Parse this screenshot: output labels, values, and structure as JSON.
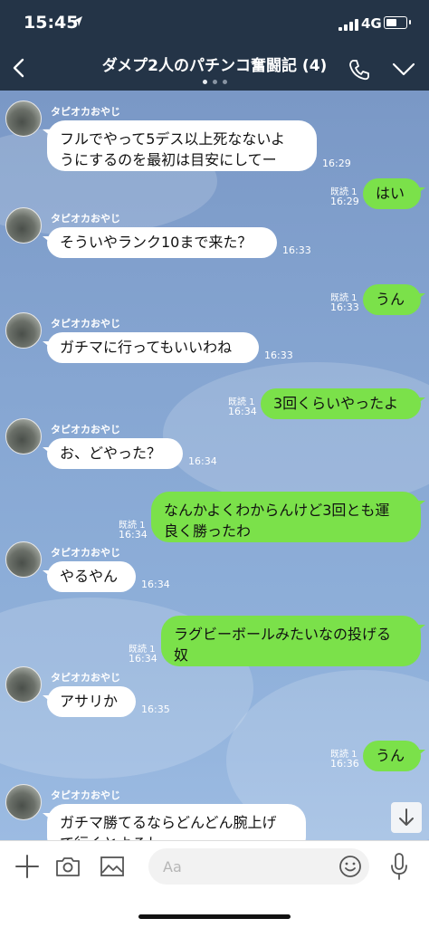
{
  "status_bar": {
    "time": "15:45",
    "network": "4G"
  },
  "header": {
    "title": "ダメプ2人のパチンコ奮闘記 (4)"
  },
  "contact": {
    "name": "タピオカおやじ"
  },
  "messages": [
    {
      "side": "in",
      "lines": [
        "フルでやって5デス以上死なないよ",
        "うにするのを最初は目安にしてー"
      ],
      "time": "16:29"
    },
    {
      "side": "out",
      "lines": [
        "はい"
      ],
      "read": "既読 1",
      "time": "16:29"
    },
    {
      "side": "in",
      "lines": [
        "そういやランク10まで来た？"
      ],
      "time": "16:33"
    },
    {
      "side": "out",
      "lines": [
        "うん"
      ],
      "read": "既読 1",
      "time": "16:33"
    },
    {
      "side": "in",
      "lines": [
        "ガチマに行ってもいいわね"
      ],
      "time": "16:33"
    },
    {
      "side": "out",
      "lines": [
        "3回くらいやったよ"
      ],
      "read": "既読 1",
      "time": "16:34"
    },
    {
      "side": "in",
      "lines": [
        "お、どやった？"
      ],
      "time": "16:34"
    },
    {
      "side": "out",
      "lines": [
        "なんかよくわからんけど3回とも運",
        "良く勝ったわ"
      ],
      "read": "既読 1",
      "time": "16:34"
    },
    {
      "side": "in",
      "lines": [
        "やるやん"
      ],
      "time": "16:34"
    },
    {
      "side": "out",
      "lines": [
        "ラグビーボールみたいなの投げる",
        "奴"
      ],
      "read": "既読 1",
      "time": "16:34"
    },
    {
      "side": "in",
      "lines": [
        "アサリか"
      ],
      "time": "16:35"
    },
    {
      "side": "out",
      "lines": [
        "うん"
      ],
      "read": "既読 1",
      "time": "16:36"
    },
    {
      "side": "in",
      "lines": [
        "ガチマ勝てるならどんどん腕上げ",
        "て行くとよろし"
      ],
      "time": ""
    }
  ],
  "input": {
    "placeholder": "Aa"
  },
  "icons": [
    "back-icon",
    "phone-icon",
    "chevron-down-icon",
    "plus-icon",
    "camera-icon",
    "image-icon",
    "emoji-icon",
    "mic-icon",
    "scroll-down-icon"
  ],
  "colors": {
    "header": "#243447",
    "chat_background": "#7f9fcd",
    "outgoing_bubble": "#7be14a",
    "incoming_bubble": "#ffffff"
  }
}
